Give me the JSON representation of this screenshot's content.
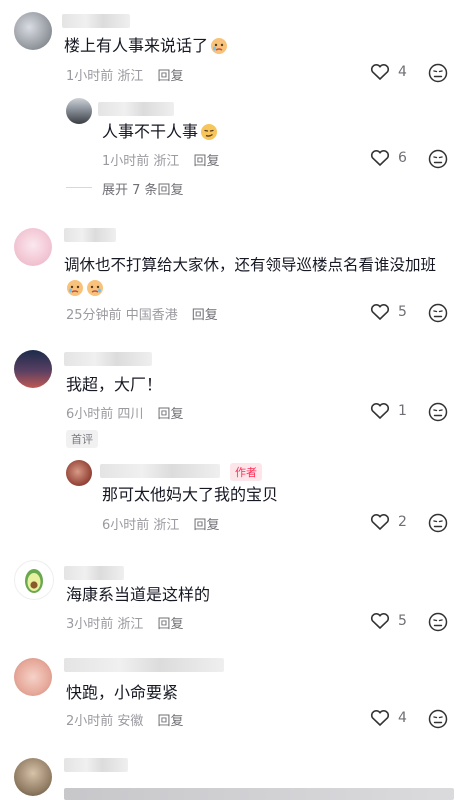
{
  "colors": {
    "text": "#161823",
    "meta": "#9a9aa0",
    "author_badge": "#fe2c55"
  },
  "comments": [
    {
      "text": "楼上有人事来说话了",
      "time": "1小时前",
      "location": "浙江",
      "reply": "回复",
      "likes": "4",
      "emoji": "crying-face-emoji"
    },
    {
      "text": "人事不干人事",
      "time": "1小时前",
      "location": "浙江",
      "reply": "回复",
      "likes": "6",
      "emoji": "smirk-face-emoji",
      "expand": "展开 7 条回复"
    },
    {
      "text": "调休也不打算给大家休，还有领导巡楼点名看谁没加班",
      "time": "25分钟前",
      "location": "中国香港",
      "reply": "回复",
      "likes": "5",
      "emoji": "crying-face-emoji"
    },
    {
      "text": "我超，大厂！",
      "time": "6小时前",
      "location": "四川",
      "reply": "回复",
      "likes": "1",
      "badge": "首评"
    },
    {
      "text": "那可太他妈大了我的宝贝",
      "time": "6小时前",
      "location": "浙江",
      "reply": "回复",
      "likes": "2",
      "badge": "作者"
    },
    {
      "text": "海康系当道是这样的",
      "time": "3小时前",
      "location": "浙江",
      "reply": "回复",
      "likes": "5"
    },
    {
      "text": "快跑，小命要紧",
      "time": "2小时前",
      "location": "安徽",
      "reply": "回复",
      "likes": "4"
    }
  ]
}
